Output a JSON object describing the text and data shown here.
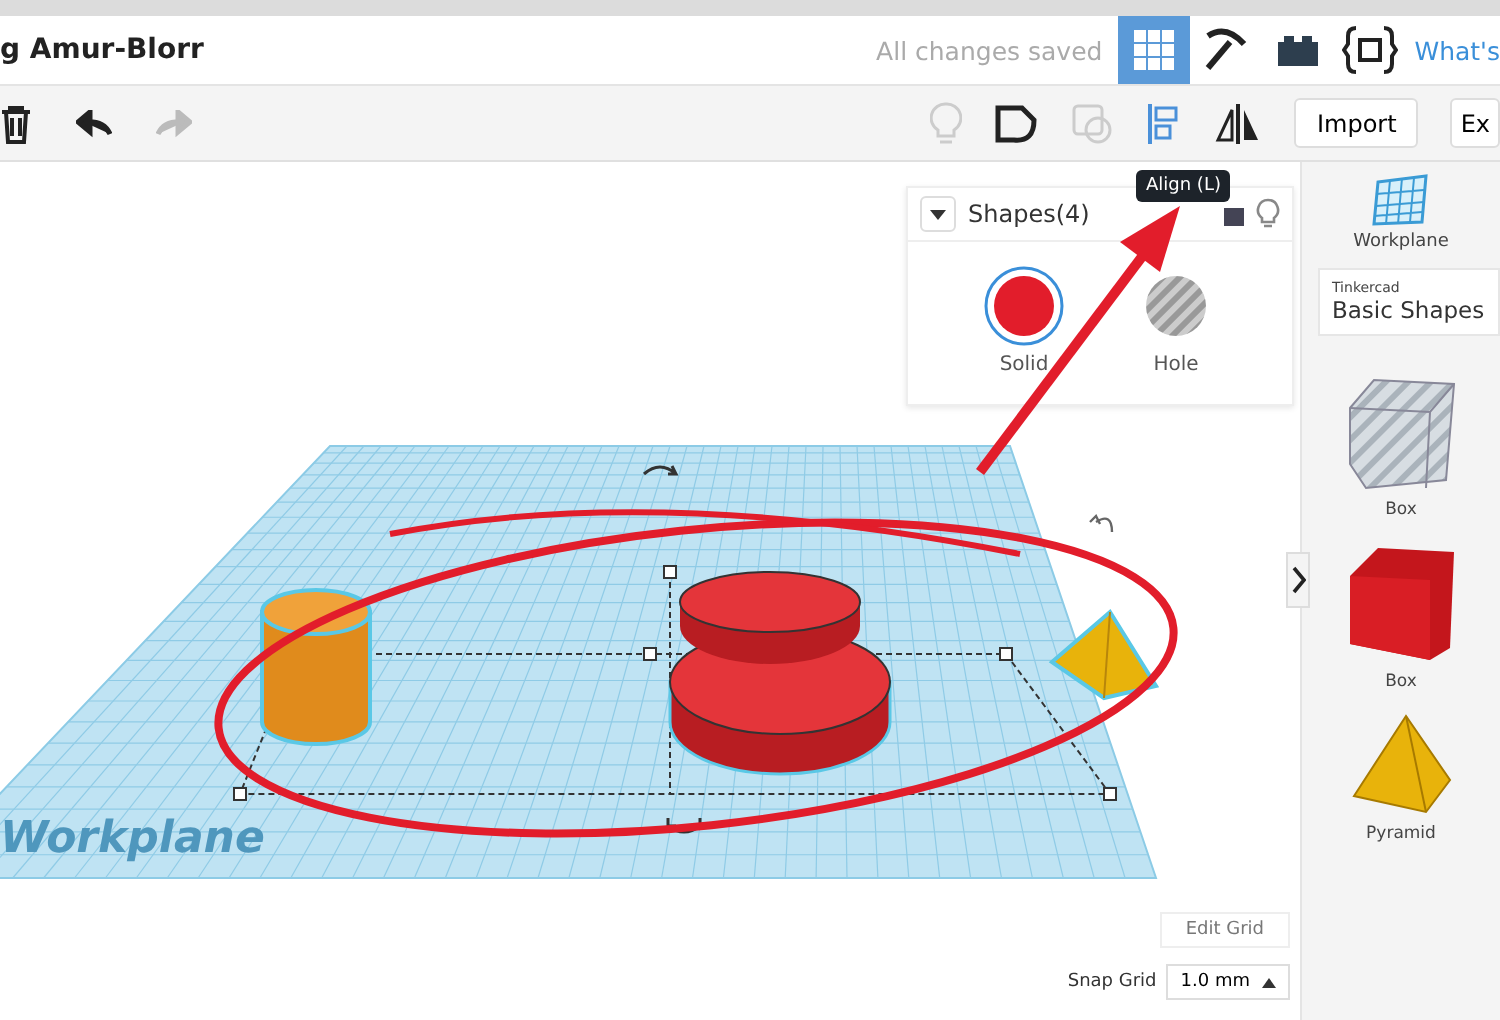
{
  "header": {
    "title": "g Amur-Blorr",
    "save_status": "All changes saved",
    "whats_new": "What's"
  },
  "toolbar": {
    "import": "Import",
    "export": "Ex"
  },
  "tooltip": "Align (L)",
  "inspector": {
    "title": "Shapes(4)",
    "options": [
      {
        "label": "Solid",
        "kind": "solid",
        "selected": true
      },
      {
        "label": "Hole",
        "kind": "hole",
        "selected": false
      }
    ]
  },
  "canvas": {
    "plane_label": "Workplane",
    "edit_grid": "Edit Grid",
    "snap_grid": {
      "label": "Snap Grid",
      "value": "1.0 mm"
    }
  },
  "sidebar": {
    "workplane": "Workplane",
    "category": {
      "brand": "Tinkercad",
      "title": "Basic Shapes"
    },
    "items": [
      {
        "label": "Box",
        "kind": "hole-box"
      },
      {
        "label": "Box",
        "kind": "box"
      },
      {
        "label": "Pyramid",
        "kind": "pyramid"
      }
    ]
  }
}
